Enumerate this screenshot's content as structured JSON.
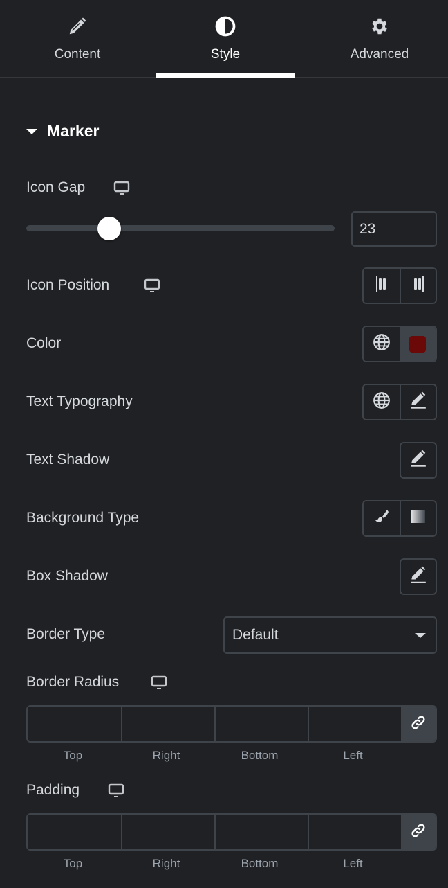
{
  "tabs": [
    {
      "label": "Content",
      "icon": "pencil-icon",
      "active": false
    },
    {
      "label": "Style",
      "icon": "half-circle-icon",
      "active": true
    },
    {
      "label": "Advanced",
      "icon": "gear-icon",
      "active": false
    }
  ],
  "section": {
    "title": "Marker",
    "expanded": true
  },
  "controls": {
    "icon_gap": {
      "label": "Icon Gap",
      "value": "23",
      "slider_fraction": 0.23
    },
    "icon_position": {
      "label": "Icon Position",
      "options": [
        "align-left-icon",
        "align-right-icon"
      ]
    },
    "color": {
      "label": "Color",
      "swatch": "#6b0808"
    },
    "text_typography": {
      "label": "Text Typography"
    },
    "text_shadow": {
      "label": "Text Shadow"
    },
    "background_type": {
      "label": "Background Type",
      "options": [
        "classic-brush-icon",
        "gradient-icon"
      ]
    },
    "box_shadow": {
      "label": "Box Shadow"
    },
    "border_type": {
      "label": "Border Type",
      "value": "Default"
    },
    "border_radius": {
      "label": "Border Radius",
      "fields": [
        "Top",
        "Right",
        "Bottom",
        "Left"
      ],
      "values": [
        "",
        "",
        "",
        ""
      ]
    },
    "padding": {
      "label": "Padding",
      "fields": [
        "Top",
        "Right",
        "Bottom",
        "Left"
      ],
      "values": [
        "",
        "",
        "",
        ""
      ]
    }
  },
  "colors": {
    "background": "#1f2124",
    "border": "#3f444b",
    "text": "#d5d8dc",
    "accent": "#ffffff"
  }
}
